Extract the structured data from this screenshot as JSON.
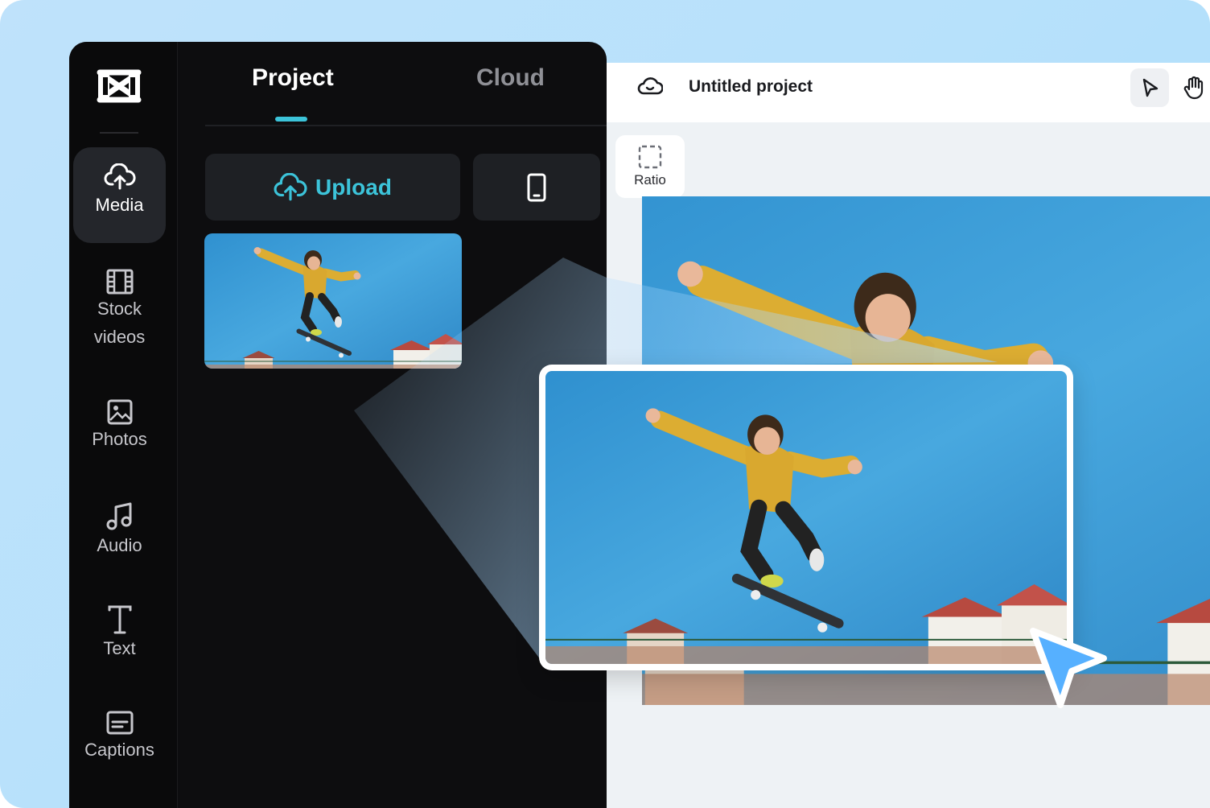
{
  "sidebar": {
    "items": [
      {
        "label": "Media",
        "icon": "cloud-upload-icon",
        "active": true
      },
      {
        "label": "Stock\nvideos",
        "icon": "film-icon",
        "active": false
      },
      {
        "label": "Photos",
        "icon": "image-icon",
        "active": false
      },
      {
        "label": "Audio",
        "icon": "music-note-icon",
        "active": false
      },
      {
        "label": "Text",
        "icon": "text-t-icon",
        "active": false
      },
      {
        "label": "Captions",
        "icon": "captions-icon",
        "active": false
      }
    ]
  },
  "panel": {
    "tabs": [
      {
        "label": "Project",
        "active": true
      },
      {
        "label": "Cloud",
        "active": false
      }
    ],
    "upload_label": "Upload",
    "phone_icon": "phone-icon"
  },
  "editor": {
    "project_title": "Untitled project",
    "ratio_label": "Ratio",
    "tools": [
      "pointer-icon",
      "hand-icon"
    ]
  },
  "colors": {
    "accent": "#3cc3d9",
    "cursor": "#56b0ff",
    "panel_bg": "#0d0d0f"
  }
}
